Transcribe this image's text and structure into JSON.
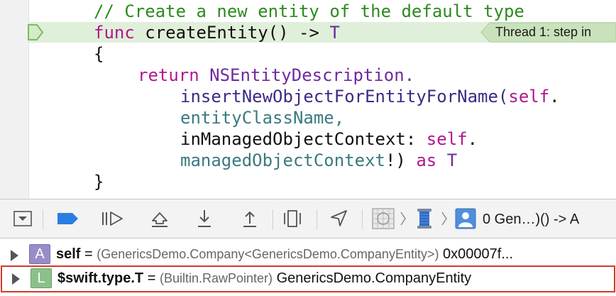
{
  "code": {
    "lines": [
      "// Create a new entity of the default type",
      "func",
      "createEntity() ->",
      "T",
      "{",
      "return",
      "NSEntityDescription.",
      "insertNewObjectForEntityForName(",
      "self",
      ".",
      "entityClassName,",
      "inManagedObjectContext:",
      "self",
      ".",
      "managedObjectContext",
      "!)",
      "as",
      "T",
      "}"
    ],
    "thread_indicator": "Thread 1: step in"
  },
  "toolbar": {
    "buttons": [
      "hide-debug-area",
      "toggle-breakpoints",
      "continue",
      "step-over",
      "step-into",
      "step-out",
      "debug-view-hierarchy",
      "simulate-location"
    ],
    "breadcrumb_label": "0 Gen…)() -> A"
  },
  "variables": [
    {
      "badge": "A",
      "name": "self",
      "equals": "=",
      "type": "(GenericsDemo.Company<GenericsDemo.CompanyEntity>)",
      "value": "0x00007f..."
    },
    {
      "badge": "L",
      "name": "$swift.type.T",
      "equals": "=",
      "type": "(Builtin.RawPointer)",
      "value": "GenericsDemo.CompanyEntity"
    }
  ],
  "colors": {
    "current_line": "#e0efd9",
    "comment": "#2c8a1e",
    "keyword": "#b0188f",
    "highlight_border": "#d23a2a",
    "breakpoint_blue": "#2a7de1"
  }
}
